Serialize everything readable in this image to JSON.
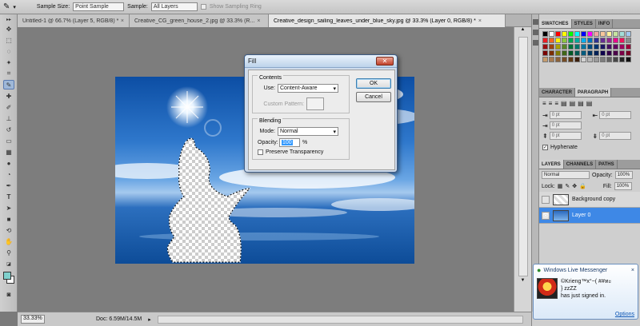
{
  "options_bar": {
    "sample_size_label": "Sample Size:",
    "sample_size_value": "Point Sample",
    "sample_label": "Sample:",
    "sample_value": "All Layers",
    "show_ring_label": "Show Sampling Ring"
  },
  "tabs": [
    {
      "label": "Untitled-1 @ 66.7% (Layer 5, RGB/8) *"
    },
    {
      "label": "Creative_CG_green_house_2.jpg @ 33.3% (R..."
    },
    {
      "label": "Creative_design_sailing_leaves_under_blue_sky.jpg @ 33.3% (Layer 0, RGB/8) *"
    }
  ],
  "status": {
    "zoom": "33.33%",
    "doc": "Doc: 6.59M/14.5M"
  },
  "fill_dialog": {
    "title": "Fill",
    "contents_label": "Contents",
    "use_label": "Use:",
    "use_value": "Content-Aware",
    "custom_pattern_label": "Custom Pattern:",
    "blending_label": "Blending",
    "mode_label": "Mode:",
    "mode_value": "Normal",
    "opacity_label": "Opacity:",
    "opacity_value": "100",
    "opacity_unit": "%",
    "preserve_label": "Preserve Transparency",
    "ok_label": "OK",
    "cancel_label": "Cancel"
  },
  "swatches_panel": {
    "tabs": [
      "SWATCHES",
      "STYLES",
      "INFO"
    ],
    "colors": [
      "#000000",
      "#ffffff",
      "#ff0000",
      "#ffff00",
      "#00ff00",
      "#00ffff",
      "#0000ff",
      "#ff00ff",
      "#f2a3a3",
      "#f7c69b",
      "#fff39b",
      "#c5e3a0",
      "#a3dfd9",
      "#a3c9f0",
      "#ed1c24",
      "#f26522",
      "#fff200",
      "#8dc63f",
      "#00a651",
      "#00a99d",
      "#00aeef",
      "#0072bc",
      "#2e3192",
      "#662d91",
      "#92278f",
      "#ec008c",
      "#ed145b",
      "#898989",
      "#9e0b0f",
      "#a0410d",
      "#aba000",
      "#598527",
      "#007236",
      "#00746b",
      "#0076a3",
      "#004a80",
      "#003471",
      "#1b1464",
      "#440e62",
      "#630460",
      "#9e005d",
      "#9e0039",
      "#790000",
      "#7b2e00",
      "#827b00",
      "#406618",
      "#005826",
      "#005952",
      "#005b7f",
      "#003663",
      "#002157",
      "#0d004c",
      "#32004b",
      "#4b0049",
      "#7b0046",
      "#7a0026",
      "#c69c6d",
      "#a67c52",
      "#8c6239",
      "#754c24",
      "#603913",
      "#3c1f0d",
      "#d2d2d2",
      "#b7b7b7",
      "#9b9b9b",
      "#7e7e7e",
      "#636363",
      "#464646",
      "#252525",
      "#111111"
    ]
  },
  "char_panel": {
    "tabs": [
      "CHARACTER",
      "PARAGRAPH"
    ],
    "indent_values": [
      "0 pt",
      "0 pt",
      "0 pt",
      "0 pt",
      "0 pt"
    ],
    "hyphenate_label": "Hyphenate"
  },
  "layers_panel": {
    "tabs": [
      "LAYERS",
      "CHANNELS",
      "PATHS"
    ],
    "blend_mode": "Normal",
    "opacity_label": "Opacity:",
    "opacity_value": "100%",
    "lock_label": "Lock:",
    "fill_label": "Fill:",
    "fill_value": "100%",
    "layers": [
      {
        "name": "Background copy",
        "selected": false
      },
      {
        "name": "Layer 0",
        "selected": true
      }
    ]
  },
  "messenger": {
    "title": "Windows Live Messenger",
    "line1": "©Krieng™x°~( ##ทะ",
    "line2": "} zzZZ",
    "line3": "has just signed in.",
    "options": "Options"
  }
}
